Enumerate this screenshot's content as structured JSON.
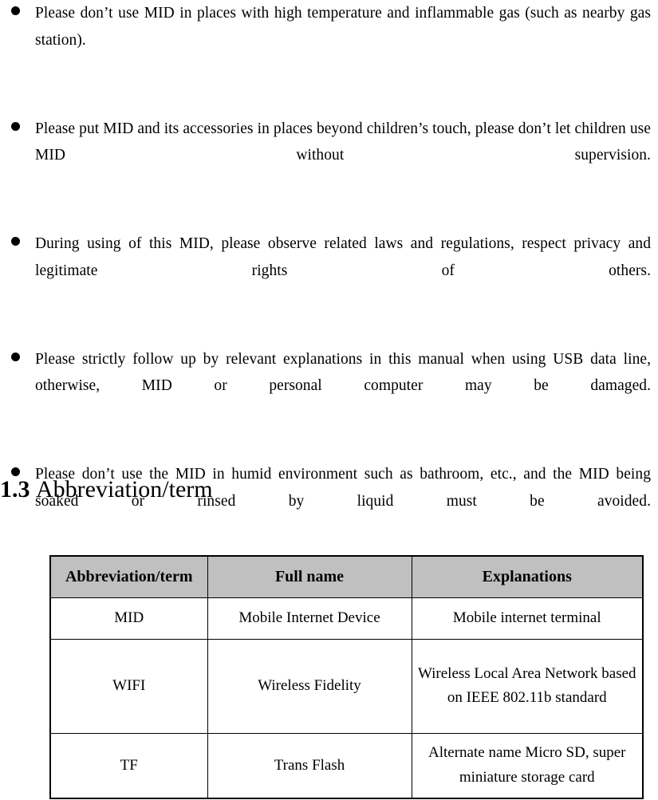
{
  "document": {
    "bullets": [
      {
        "marker": "bullet-dot",
        "text": "Please don’t use MID in places with high temperature and inflammable gas (such as nearby gas station)."
      },
      {
        "marker": "bullet-dot",
        "text": "Please put MID and its accessories in places beyond children’s touch, please don’t let children use MID without supervision."
      },
      {
        "marker": "bullet-dot",
        "text": "During using of this MID, please observe related laws and regulations, respect privacy and legitimate rights of others."
      },
      {
        "marker": "bullet-dot",
        "text": "Please strictly follow up by relevant explanations in this manual when using USB data line, otherwise, MID or personal computer may be damaged."
      },
      {
        "marker": "bullet-dot",
        "text": "Please don’t use the MID in humid environment such as bathroom, etc., and the MID being soaked or rinsed by liquid must be avoided."
      }
    ],
    "heading": {
      "number": "1.3",
      "title": "Abbreviation/term"
    },
    "table": {
      "headers": [
        "Abbreviation/term",
        "Full name",
        "Explanations"
      ],
      "header_background": "#c0c0c0",
      "rows": [
        {
          "abbreviation": "MID",
          "full_name": "Mobile Internet Device",
          "explanation": "Mobile internet terminal"
        },
        {
          "abbreviation": "WIFI",
          "full_name": "Wireless Fidelity",
          "explanation": "Wireless Local Area Network based on IEEE 802.11b standard"
        },
        {
          "abbreviation": "TF",
          "full_name": "Trans Flash",
          "explanation": "Alternate name Micro SD, super miniature storage card"
        }
      ]
    }
  }
}
